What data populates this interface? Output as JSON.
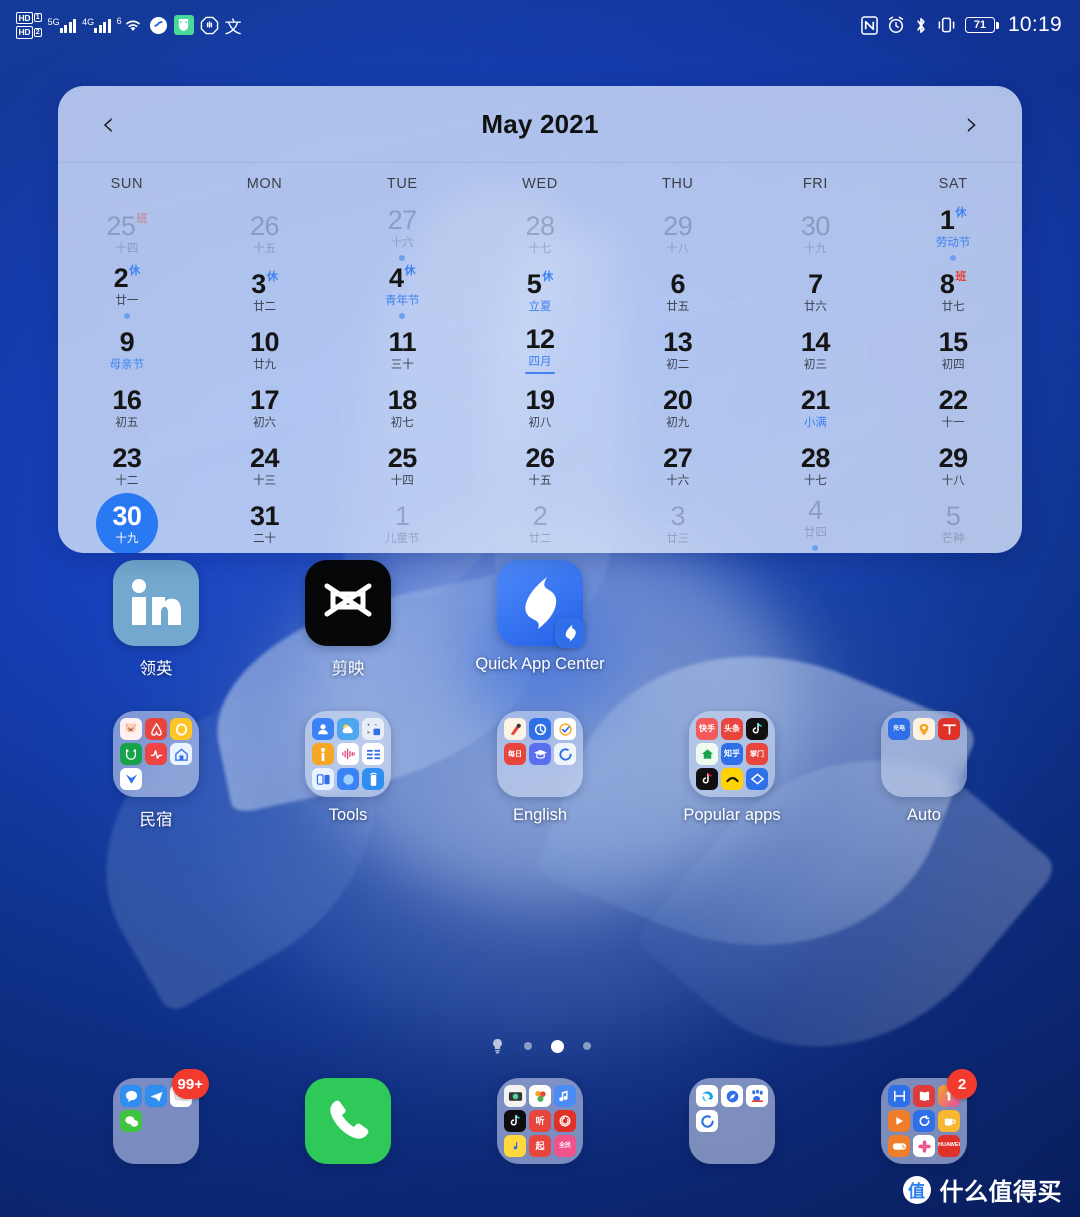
{
  "statusbar": {
    "left_icons": [
      {
        "name": "hd-volte-1",
        "label": "HD",
        "sub": "1"
      },
      {
        "name": "hd-volte-2",
        "label": "HD",
        "sub": "2"
      },
      {
        "name": "signal-5g",
        "gen": "5G"
      },
      {
        "name": "signal-4g",
        "gen": "4G"
      },
      {
        "name": "wifi-6",
        "gen": "6"
      },
      {
        "name": "vpn-icon"
      },
      {
        "name": "security-shield-icon"
      },
      {
        "name": "do-not-disturb-icon"
      },
      {
        "name": "input-method-icon",
        "label": "文"
      }
    ],
    "right": {
      "nfc": "N",
      "alarm": "alarm-icon",
      "bluetooth": "bluetooth-icon",
      "vibrate": "vibrate-icon",
      "battery_percent": "71",
      "time": "10:19"
    }
  },
  "calendar": {
    "prev_label": "‹",
    "next_label": "›",
    "title": "May 2021",
    "weekdays": [
      "SUN",
      "MON",
      "TUE",
      "WED",
      "THU",
      "FRI",
      "SAT"
    ],
    "weeks": [
      [
        {
          "d": "25",
          "lun": "十四",
          "sup": "班",
          "suptype": "work",
          "other": true
        },
        {
          "d": "26",
          "lun": "十五",
          "other": true
        },
        {
          "d": "27",
          "lun": "十六",
          "other": true,
          "dot": true
        },
        {
          "d": "28",
          "lun": "十七",
          "other": true
        },
        {
          "d": "29",
          "lun": "十八",
          "other": true
        },
        {
          "d": "30",
          "lun": "十九",
          "other": true
        },
        {
          "d": "1",
          "lun": "劳动节",
          "sup": "休",
          "suptype": "rest",
          "lunhl": true,
          "dot": true
        }
      ],
      [
        {
          "d": "2",
          "lun": "廿一",
          "sup": "休",
          "suptype": "rest",
          "dot": true
        },
        {
          "d": "3",
          "lun": "廿二",
          "sup": "休",
          "suptype": "rest"
        },
        {
          "d": "4",
          "lun": "青年节",
          "sup": "休",
          "suptype": "rest",
          "lunhl": true,
          "dot": true
        },
        {
          "d": "5",
          "lun": "立夏",
          "sup": "休",
          "suptype": "rest",
          "lunhl": true
        },
        {
          "d": "6",
          "lun": "廿五"
        },
        {
          "d": "7",
          "lun": "廿六"
        },
        {
          "d": "8",
          "lun": "廿七",
          "sup": "班",
          "suptype": "work"
        }
      ],
      [
        {
          "d": "9",
          "lun": "母亲节",
          "lunhl": true
        },
        {
          "d": "10",
          "lun": "廿九"
        },
        {
          "d": "11",
          "lun": "三十"
        },
        {
          "d": "12",
          "lun": "四月",
          "lunhl": true,
          "uline": true
        },
        {
          "d": "13",
          "lun": "初二"
        },
        {
          "d": "14",
          "lun": "初三"
        },
        {
          "d": "15",
          "lun": "初四"
        }
      ],
      [
        {
          "d": "16",
          "lun": "初五"
        },
        {
          "d": "17",
          "lun": "初六"
        },
        {
          "d": "18",
          "lun": "初七"
        },
        {
          "d": "19",
          "lun": "初八"
        },
        {
          "d": "20",
          "lun": "初九"
        },
        {
          "d": "21",
          "lun": "小满",
          "lunhl": true
        },
        {
          "d": "22",
          "lun": "十一"
        }
      ],
      [
        {
          "d": "23",
          "lun": "十二"
        },
        {
          "d": "24",
          "lun": "十三"
        },
        {
          "d": "25",
          "lun": "十四"
        },
        {
          "d": "26",
          "lun": "十五"
        },
        {
          "d": "27",
          "lun": "十六"
        },
        {
          "d": "28",
          "lun": "十七"
        },
        {
          "d": "29",
          "lun": "十八"
        }
      ],
      [
        {
          "d": "30",
          "lun": "十九",
          "today": true
        },
        {
          "d": "31",
          "lun": "二十"
        },
        {
          "d": "1",
          "lun": "儿童节",
          "other": true
        },
        {
          "d": "2",
          "lun": "廿二",
          "other": true
        },
        {
          "d": "3",
          "lun": "廿三",
          "other": true
        },
        {
          "d": "4",
          "lun": "廿四",
          "other": true,
          "dot": true
        },
        {
          "d": "5",
          "lun": "芒种",
          "other": true
        }
      ]
    ]
  },
  "home": {
    "row1": [
      {
        "name": "linkedin",
        "label": "领英",
        "type": "app"
      },
      {
        "name": "capcut",
        "label": "剪映",
        "type": "app"
      },
      {
        "name": "quick-app-center",
        "label": "Quick App Center",
        "type": "app"
      },
      null,
      null
    ],
    "row2": [
      {
        "name": "minsu-folder",
        "label": "民宿",
        "type": "folder"
      },
      {
        "name": "tools-folder",
        "label": "Tools",
        "type": "folder"
      },
      {
        "name": "english-folder",
        "label": "English",
        "type": "folder"
      },
      {
        "name": "popular-apps-folder",
        "label": "Popular apps",
        "type": "folder"
      },
      {
        "name": "auto-folder",
        "label": "Auto",
        "type": "folder"
      }
    ]
  },
  "pager": {
    "pages": 4,
    "active_index": 2,
    "first_is_assistant": true
  },
  "dock": [
    {
      "name": "social-folder",
      "badge": "99+"
    },
    {
      "name": "phone-app",
      "badge": null
    },
    {
      "name": "media-folder",
      "badge": null
    },
    {
      "name": "browser-folder",
      "badge": null
    },
    {
      "name": "huawei-folder",
      "badge": "2"
    }
  ],
  "watermark": {
    "mark": "值",
    "text": "什么值得买"
  },
  "colors": {
    "accent": "#2979f2",
    "rest": "#3f82f0",
    "work": "#e8452f",
    "badge": "#f23a2e",
    "phone_green": "#2fc95a",
    "wallpaper_blue": "#1848c8"
  }
}
